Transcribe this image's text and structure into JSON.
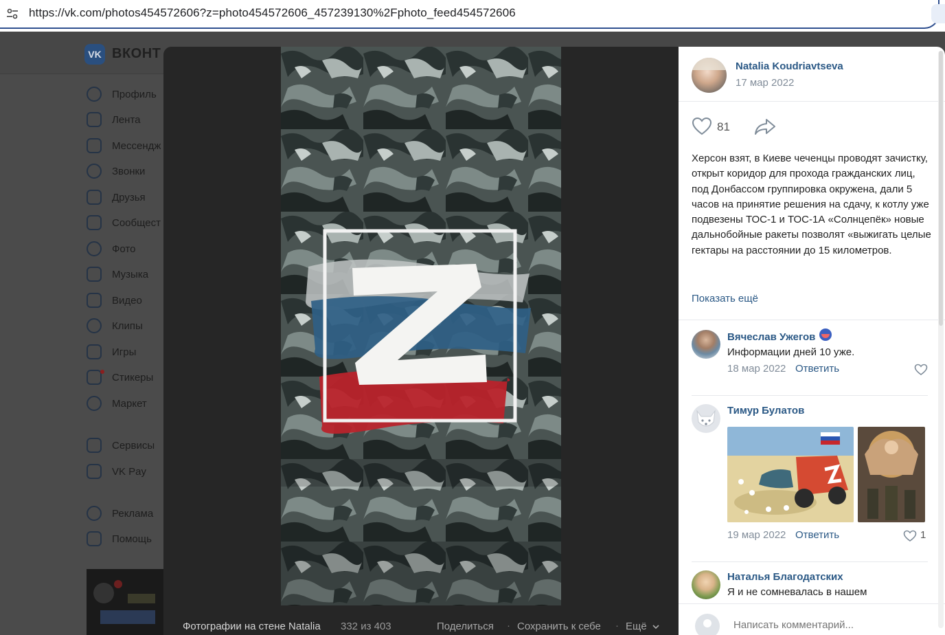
{
  "browser": {
    "url": "https://vk.com/photos454572606?z=photo454572606_457239130%2Fphoto_feed454572606"
  },
  "background_page": {
    "brand": "ВКОНТ",
    "logo_text": "VK",
    "nav": [
      {
        "label": "Профиль",
        "icon": "profile-icon"
      },
      {
        "label": "Лента",
        "icon": "news-icon"
      },
      {
        "label": "Мессендж",
        "icon": "messenger-icon"
      },
      {
        "label": "Звонки",
        "icon": "phone-icon"
      },
      {
        "label": "Друзья",
        "icon": "friends-icon"
      },
      {
        "label": "Сообщест",
        "icon": "communities-icon"
      },
      {
        "label": "Фото",
        "icon": "photo-icon"
      },
      {
        "label": "Музыка",
        "icon": "music-icon"
      },
      {
        "label": "Видео",
        "icon": "video-icon"
      },
      {
        "label": "Клипы",
        "icon": "clips-icon"
      },
      {
        "label": "Игры",
        "icon": "games-icon"
      },
      {
        "label": "Стикеры",
        "icon": "stickers-icon"
      },
      {
        "label": "Маркет",
        "icon": "market-icon"
      },
      {
        "label": "Сервисы",
        "icon": "services-icon"
      },
      {
        "label": "VK Pay",
        "icon": "vkpay-icon"
      },
      {
        "label": "Реклама",
        "icon": "ads-icon"
      },
      {
        "label": "Помощь",
        "icon": "help-icon"
      }
    ]
  },
  "viewer": {
    "footer": {
      "album": "Фотографии на стене Natalia",
      "counter": "332 из 403",
      "share": "Поделиться",
      "save": "Сохранить к себе",
      "more": "Ещё"
    },
    "post": {
      "author": "Natalia Koudriavtseva",
      "date": "17 мар 2022",
      "likes": "81",
      "text": "Херсон взят, в Киеве чеченцы проводят зачистку, открыт коридор для прохода гражданских лиц, под Донбассом группировка окружена, дали 5 часов на принятие решения на сдачу, к котлу уже подвезены ТОС-1 и ТОС-1А «Солнцепёк» новые дальнобойные ракеты позволят «выжигать целые гектары на расстоянии до 15 километров.",
      "show_more": "Показать ещё"
    },
    "comments": [
      {
        "author": "Вячеслав Ужегов",
        "text": "Информации дней 10 уже.",
        "date": "18 мар 2022",
        "reply": "Ответить",
        "likes": ""
      },
      {
        "author": "Тимур Булатов",
        "text": "",
        "date": "19 мар 2022",
        "reply": "Ответить",
        "likes": "1"
      },
      {
        "author": "Наталья Благодатских",
        "text": "Я и не сомневалась в нашем",
        "date": "",
        "reply": "",
        "likes": ""
      }
    ],
    "composer_placeholder": "Написать комментарий..."
  },
  "colors": {
    "link": "#2a5885",
    "muted": "#818c99",
    "accent_frame": "#2f4f8f"
  }
}
